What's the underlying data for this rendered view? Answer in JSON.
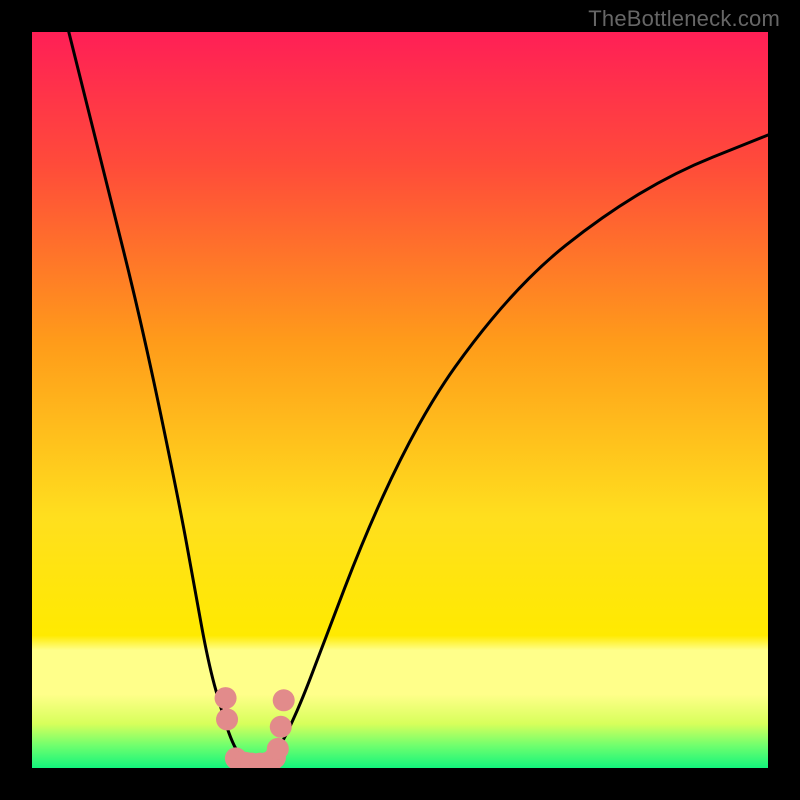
{
  "watermark": "TheBottleneck.com",
  "chart_data": {
    "type": "line",
    "title": "",
    "xlabel": "",
    "ylabel": "",
    "xlim": [
      0,
      100
    ],
    "ylim": [
      0,
      100
    ],
    "grid": false,
    "series": [
      {
        "name": "curve",
        "x": [
          5,
          10,
          15,
          20,
          22,
          24,
          26,
          27,
          28,
          29,
          30,
          31,
          32,
          33,
          34,
          35,
          37,
          40,
          45,
          50,
          55,
          60,
          65,
          70,
          75,
          80,
          85,
          90,
          95,
          100
        ],
        "y": [
          100,
          80,
          60,
          36,
          25,
          14,
          7,
          4,
          2,
          1,
          0.5,
          0.5,
          1,
          2,
          3.5,
          5.5,
          10,
          18,
          31,
          42,
          51,
          58,
          64,
          69,
          73,
          76.5,
          79.5,
          82,
          84,
          86
        ]
      }
    ],
    "markers": {
      "name": "points",
      "color": "#e28b8b",
      "x": [
        26.3,
        26.5,
        27.7,
        28.5,
        29.0,
        29.8,
        31.0,
        32.0,
        32.5,
        33.0,
        33.4,
        33.8,
        34.2
      ],
      "y": [
        9.5,
        6.6,
        1.3,
        0.8,
        0.7,
        0.6,
        0.6,
        0.7,
        0.9,
        1.4,
        2.6,
        5.6,
        9.2
      ]
    },
    "background_gradient": {
      "top_color": "#ff1f56",
      "mid_color": "#ffea00",
      "band_color": "#ffff8a",
      "bottom_color": "#13f47c"
    }
  }
}
